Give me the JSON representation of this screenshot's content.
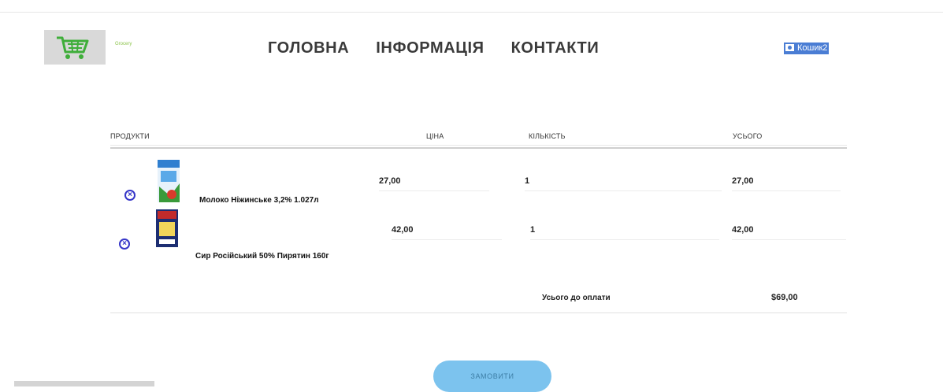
{
  "header": {
    "logo_text": "Grocery",
    "nav": [
      "ГОЛОВНА",
      "ІНФОРМАЦІЯ",
      "КОНТАКТИ"
    ],
    "cart_label": "Кошик2",
    "cart_icon": "cart-icon"
  },
  "table": {
    "columns": [
      "ПРОДУКТИ",
      "ЦІНА",
      "КІЛЬКІСТЬ",
      "УСЬОГО"
    ],
    "rows": [
      {
        "name": "Молоко Ніжинське 3,2% 1.027л",
        "price": "27,00",
        "qty": "1",
        "total": "27,00",
        "image": "milk-carton-image"
      },
      {
        "name": "Сир Російський 50% Пирятин 160г",
        "price": "42,00",
        "qty": "1",
        "total": "42,00",
        "image": "cheese-pack-image"
      }
    ]
  },
  "summary": {
    "label": "Усього до оплати",
    "value": "$69,00"
  },
  "order_button": "ЗАМОВИТИ",
  "colors": {
    "accent_blue": "#4a7dd4",
    "remove_icon": "#3535c8",
    "order_button": "#7cc3ee",
    "logo_green": "#8bc34a"
  }
}
